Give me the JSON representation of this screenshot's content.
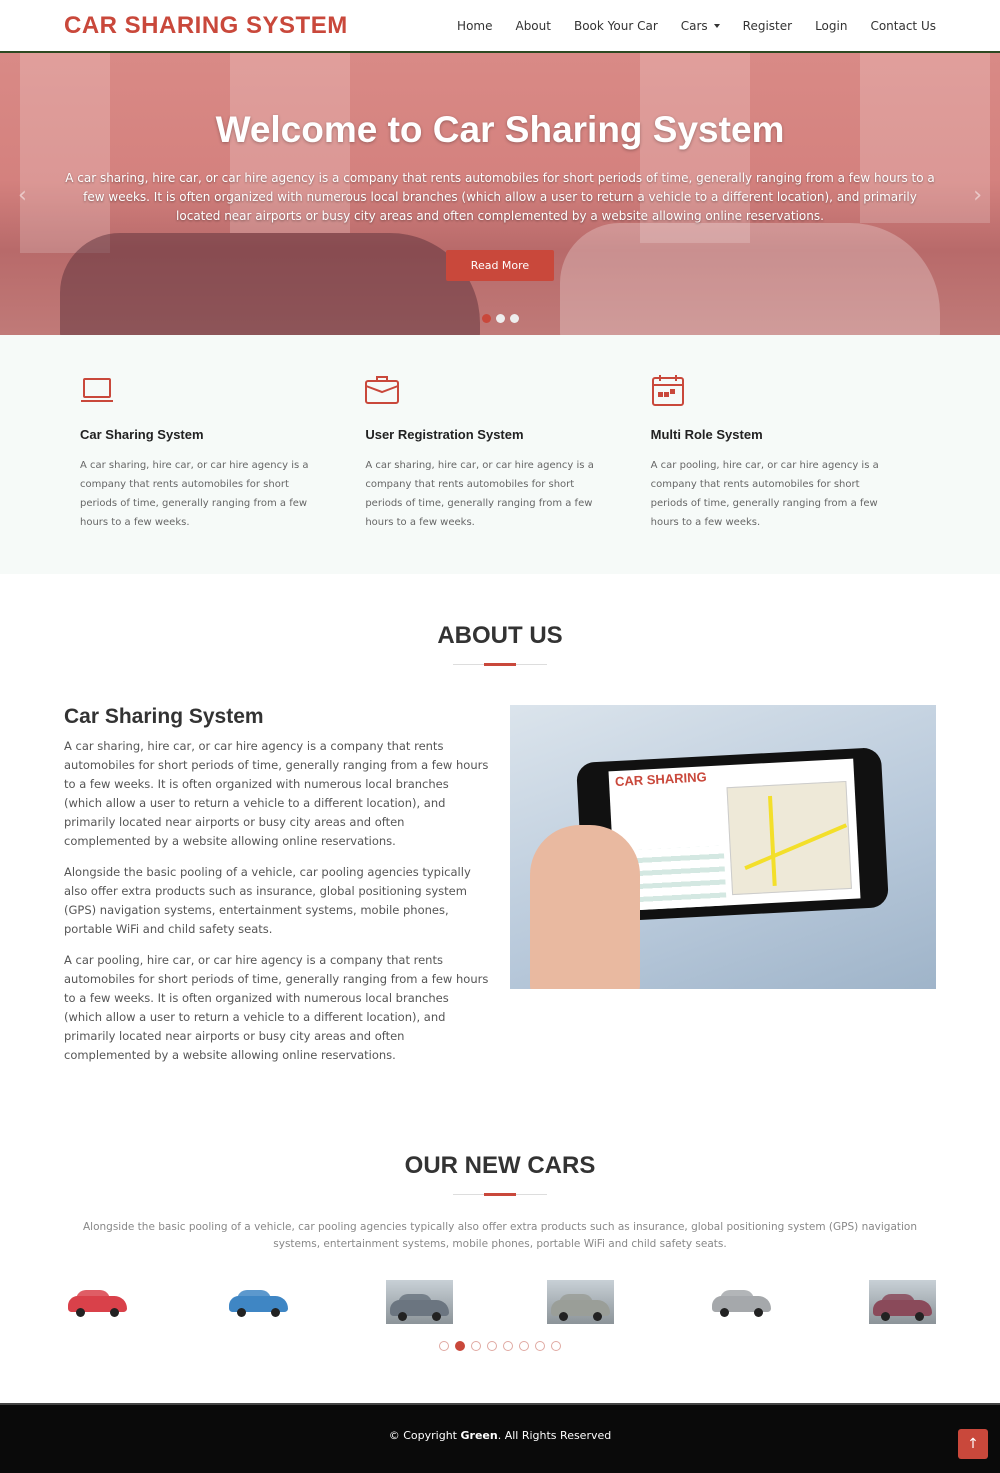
{
  "brand": "CAR SHARING SYSTEM",
  "colors": {
    "accent": "#c9483b",
    "footer": "#0a0a0a",
    "features_bg": "#f6faf8"
  },
  "nav": {
    "items": [
      "Home",
      "About",
      "Book Your Car",
      "Cars",
      "Register",
      "Login",
      "Contact Us"
    ]
  },
  "hero": {
    "title": "Welcome to Car Sharing System",
    "text": "A car sharing, hire car, or car hire agency is a company that rents automobiles for short periods of time, generally ranging from a few hours to a few weeks. It is often organized with numerous local branches (which allow a user to return a vehicle to a different location), and primarily located near airports or busy city areas and often complemented by a website allowing online reservations.",
    "button": "Read More",
    "slides": 3,
    "active_slide": 1
  },
  "features": [
    {
      "icon": "laptop-icon",
      "title": "Car Sharing System",
      "text": "A car sharing, hire car, or car hire agency is a company that rents automobiles for short periods of time, generally ranging from a few hours to a few weeks."
    },
    {
      "icon": "briefcase-icon",
      "title": "User Registration System",
      "text": "A car sharing, hire car, or car hire agency is a company that rents automobiles for short periods of time, generally ranging from a few hours to a few weeks."
    },
    {
      "icon": "calendar-icon",
      "title": "Multi Role System",
      "text": "A car pooling, hire car, or car hire agency is a company that rents automobiles for short periods of time, generally ranging from a few hours to a few weeks."
    }
  ],
  "about": {
    "title": "ABOUT US",
    "heading": "Car Sharing System",
    "paragraphs": [
      "A car sharing, hire car, or car hire agency is a company that rents automobiles for short periods of time, generally ranging from a few hours to a few weeks. It is often organized with numerous local branches (which allow a user to return a vehicle to a different location), and primarily located near airports or busy city areas and often complemented by a website allowing online reservations.",
      "Alongside the basic pooling of a vehicle, car pooling agencies typically also offer extra products such as insurance, global positioning system (GPS) navigation systems, entertainment systems, mobile phones, portable WiFi and child safety seats.",
      "A car pooling, hire car, or car hire agency is a company that rents automobiles for short periods of time, generally ranging from a few hours to a few weeks. It is often organized with numerous local branches (which allow a user to return a vehicle to a different location), and primarily located near airports or busy city areas and often complemented by a website allowing online reservations."
    ],
    "image_logo": "CAR SHARING"
  },
  "cars": {
    "title": "OUR NEW CARS",
    "text": "Alongside the basic pooling of a vehicle, car pooling agencies typically also offer extra products such as insurance, global positioning system (GPS) navigation systems, entertainment systems, mobile phones, portable WiFi and child safety seats.",
    "colors": [
      "#d9414a",
      "#3f86c4",
      "#6b7580",
      "#9a9e98",
      "#a5a8ab",
      "#8a4a5a"
    ],
    "pages": 8,
    "active_page": 2
  },
  "footer": {
    "prefix": "© Copyright ",
    "owner": "Green",
    "suffix": ". All Rights Reserved",
    "top_icon": "arrow-up-icon"
  }
}
